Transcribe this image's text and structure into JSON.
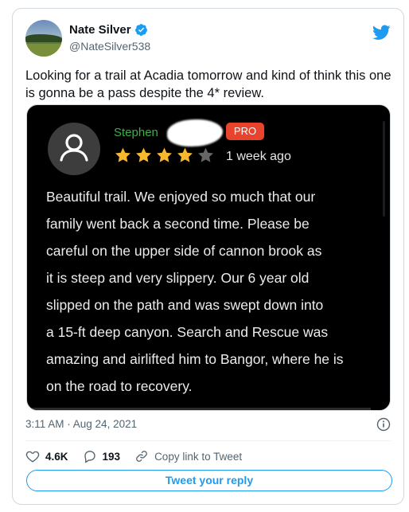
{
  "author": {
    "display_name": "Nate Silver",
    "handle": "@NateSilver538",
    "verified": true,
    "avatar_icon": "profile-photo",
    "platform_icon": "twitter-bird-icon"
  },
  "tweet": {
    "text": "Looking for a trail at Acadia tomorrow and kind of think this one is gonna be a pass despite the 4* review.",
    "timestamp": "3:11 AM · Aug 24, 2021"
  },
  "review": {
    "reviewer_name": "Stephen",
    "badge": "PRO",
    "rating": 4,
    "rating_max": 5,
    "posted": "1 week ago",
    "body": "Beautiful trail.  We enjoyed so much that our\nfamily went back a second time.  Please be\ncareful on the upper side of cannon brook as\nit is steep and very slippery.  Our 6 year old\nslipped on the path and was swept down into\na 15-ft deep canyon.  Search and Rescue was\namazing and airlifted him to Bangor, where he is\non the road to recovery.",
    "colors": {
      "name": "#3fae4a",
      "badge": "#e8432c",
      "star": "#f5b82e",
      "star_empty": "#666666"
    }
  },
  "actions": {
    "likes": "4.6K",
    "replies": "193",
    "copy_link": "Copy link to Tweet",
    "reply_button": "Tweet your reply"
  },
  "colors": {
    "accent": "#1d9bf0",
    "muted": "#536471"
  }
}
